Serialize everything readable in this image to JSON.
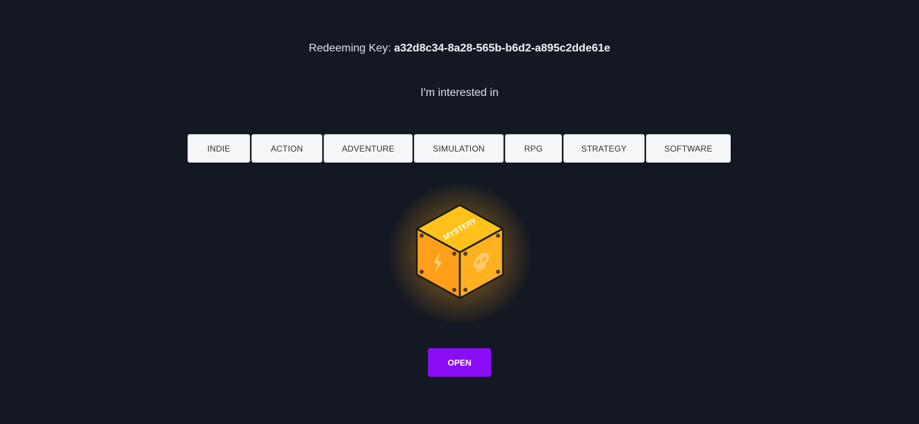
{
  "redeem": {
    "label": "Redeeming Key:",
    "key": "a32d8c34-8a28-565b-b6d2-a895c2dde61e"
  },
  "interest_label": "I'm interested in",
  "genres": [
    {
      "label": "INDIE"
    },
    {
      "label": "ACTION"
    },
    {
      "label": "ADVENTURE"
    },
    {
      "label": "SIMULATION"
    },
    {
      "label": "RPG"
    },
    {
      "label": "STRATEGY"
    },
    {
      "label": "SOFTWARE"
    }
  ],
  "mystery_box": {
    "top_text": "MYSTERY",
    "left_icon": "lightning-icon",
    "right_icon": "skull-icon",
    "colors": {
      "top": "#ffc21a",
      "left": "#ff9f1a",
      "right": "#ffb11f",
      "outline": "#1b1b1b",
      "glow": "#ffc428"
    }
  },
  "open_button": {
    "label": "OPEN",
    "color": "#8a0df5"
  }
}
